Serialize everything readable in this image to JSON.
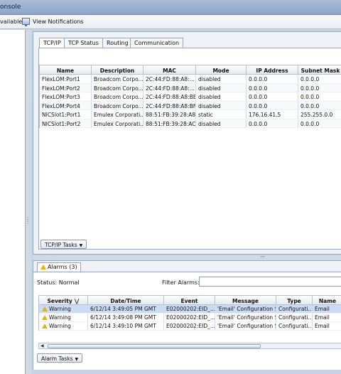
{
  "window": {
    "title_fragment": "onsole"
  },
  "menubar": {
    "alarms_fragment": "vailable",
    "view_notifications": "View Notifications"
  },
  "tabs": [
    "TCP/IP",
    "TCP Status",
    "Routing",
    "Communication"
  ],
  "tcpip_table": {
    "columns": [
      "Name",
      "Description",
      "MAC",
      "Mode",
      "IP Address",
      "Subnet Mask"
    ],
    "rows": [
      [
        "FlexLOM:Port1",
        "Broadcom Corpo...",
        "2C:44:FD:88:A8:...",
        "disabled",
        "0.0.0.0",
        "0.0.0.0"
      ],
      [
        "FlexLOM:Port2",
        "Broadcom Corpo...",
        "2C:44:FD:88:A8:...",
        "disabled",
        "0.0.0.0",
        "0.0.0.0"
      ],
      [
        "FlexLOM:Port3",
        "Broadcom Corpo...",
        "2C:44:FD:88:A8:BE",
        "disabled",
        "0.0.0.0",
        "0.0.0.0"
      ],
      [
        "FlexLOM:Port4",
        "Broadcom Corpo...",
        "2C:44:FD:88:A8:BF",
        "disabled",
        "0.0.0.0",
        "0.0.0.0"
      ],
      [
        "NICSlot1:Port1",
        "Emulex Corporati...",
        "88:51:FB:39:28:A8",
        "static",
        "176.16.41.5",
        "255.255.0.0"
      ],
      [
        "NICSlot1:Port2",
        "Emulex Corporati...",
        "88:51:FB:39:28:AC",
        "disabled",
        "0.0.0.0",
        "0.0.0.0"
      ]
    ]
  },
  "tcpip_tasks_label": "TCP/IP Tasks",
  "alarms": {
    "tab_label": "Alarms (3)",
    "status_label": "Status:",
    "status_value": "Normal",
    "filter_label": "Filter Alarms:",
    "filter_value": "",
    "columns": [
      "Severity",
      "Date/Time",
      "Event",
      "Message",
      "Type",
      "Name"
    ],
    "rows": [
      [
        "Warning",
        "6/12/14 3:49:05 PM GMT",
        "E02000202:EID_...",
        "'Email' Configuration S...",
        "Configurati...",
        "Email"
      ],
      [
        "Warning",
        "6/12/14 3:49:08 PM GMT",
        "E02000202:EID_...",
        "'Email' Configuration S...",
        "Configurati...",
        "Email"
      ],
      [
        "Warning",
        "6/12/14 3:49:10 PM GMT",
        "E02000202:EID_...",
        "'Email' Configuration S...",
        "Configurati...",
        "Email"
      ]
    ],
    "tasks_label": "Alarm Tasks"
  },
  "colors": {
    "selection": "#c9dcf6",
    "warning": "#e8b400",
    "frame": "#c7d3e4"
  },
  "icons": [
    "notifications-icon",
    "warning-icon",
    "sort-down-icon",
    "dropdown-arrow-icon",
    "scroll-left-icon"
  ]
}
